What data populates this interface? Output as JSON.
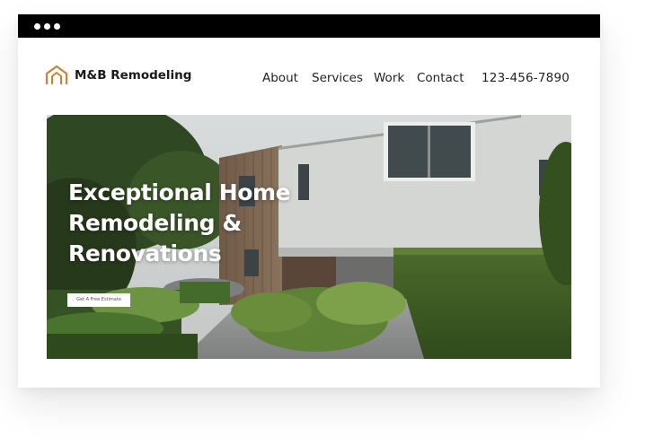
{
  "window": {
    "titlebar_color": "#000000",
    "dots": [
      "dot",
      "dot",
      "dot"
    ]
  },
  "brand": {
    "name": "M&B Remodeling",
    "logo_icon": "house-outline-icon",
    "accent_color": "#c8843a"
  },
  "nav": {
    "items": [
      {
        "label": "About"
      },
      {
        "label": "Services"
      },
      {
        "label": "Work"
      },
      {
        "label": "Contact"
      }
    ],
    "phone": "123-456-7890"
  },
  "hero": {
    "title_lines": [
      "Exceptional Home",
      "Remodeling &",
      "Renovations"
    ],
    "cta_label": "Get A Free Estimate",
    "image": "modern-house-photo"
  }
}
